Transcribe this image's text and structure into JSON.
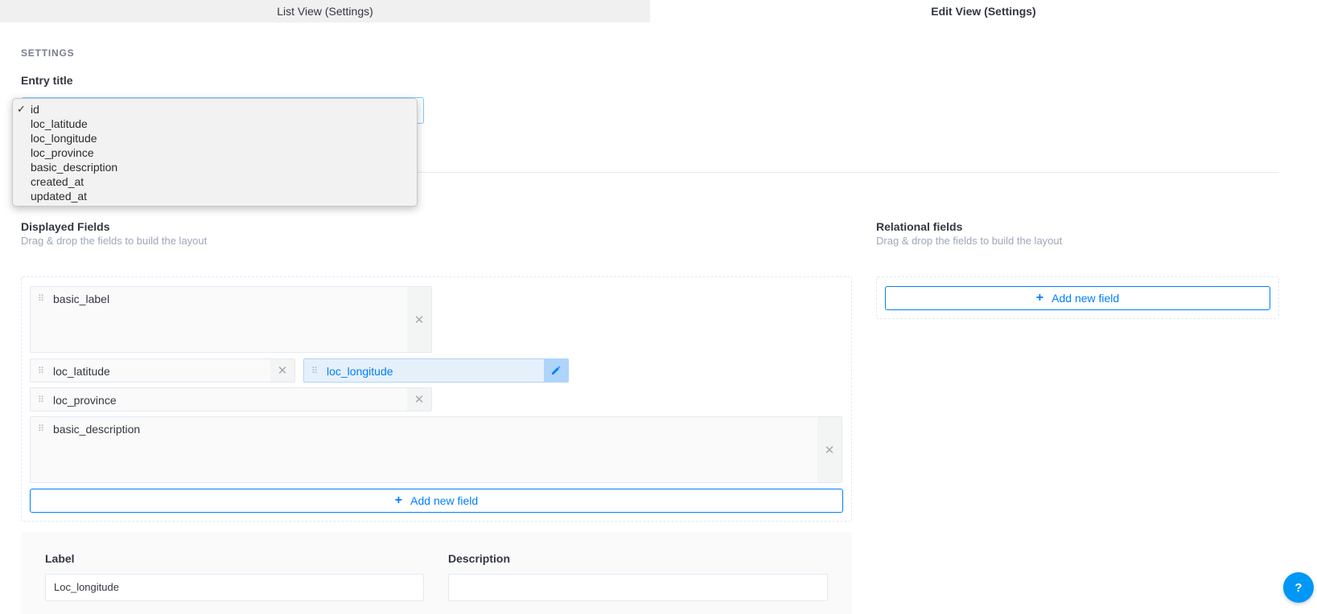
{
  "tabs": [
    {
      "label": "List View (Settings)"
    },
    {
      "label": "Edit View (Settings)"
    }
  ],
  "settings": {
    "section_title": "SETTINGS",
    "entry_title_label": "Entry title",
    "entry_title_selected": "id",
    "entry_title_options": [
      "id",
      "loc_latitude",
      "loc_longitude",
      "loc_province",
      "basic_description",
      "created_at",
      "updated_at"
    ]
  },
  "displayed": {
    "title": "Displayed Fields",
    "subtitle": "Drag & drop the fields to build the layout",
    "fields": [
      "basic_label",
      "loc_latitude",
      "loc_longitude",
      "loc_province",
      "basic_description"
    ],
    "add_label": "Add new field"
  },
  "relational": {
    "title": "Relational fields",
    "subtitle": "Drag & drop the fields to build the layout",
    "add_label": "Add new field"
  },
  "edit_panel": {
    "label_title": "Label",
    "label_value": "Loc_longitude",
    "description_title": "Description",
    "description_value": ""
  },
  "help": {
    "label": "?"
  },
  "colors": {
    "accent": "#007eff",
    "help_bg": "#0097f7"
  }
}
